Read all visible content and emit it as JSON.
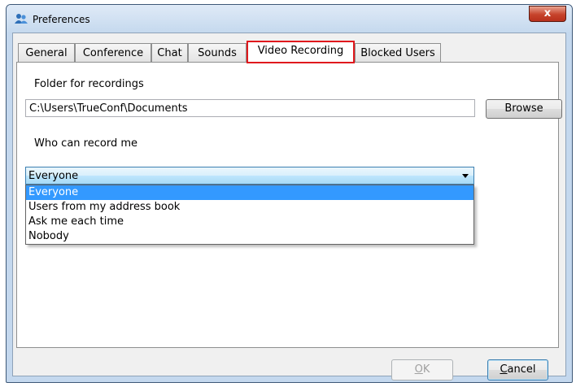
{
  "window": {
    "title": "Preferences",
    "close_label": "x"
  },
  "tabs": [
    {
      "label": "General",
      "active": false
    },
    {
      "label": "Conference",
      "active": false
    },
    {
      "label": "Chat",
      "active": false
    },
    {
      "label": "Sounds",
      "active": false
    },
    {
      "label": "Video Recording",
      "active": true
    },
    {
      "label": "Blocked Users",
      "active": false
    }
  ],
  "recording": {
    "folder_label": "Folder for recordings",
    "folder_value": "C:\\Users\\TrueConf\\Documents",
    "browse_label": "Browse",
    "who_label": "Who can record me",
    "who_selected": "Everyone",
    "options": [
      "Everyone",
      "Users from my address book",
      "Ask me each time",
      "Nobody"
    ]
  },
  "footer": {
    "ok_mnemonic": "O",
    "ok_rest": "K",
    "cancel_mnemonic": "C",
    "cancel_rest": "ancel"
  },
  "colors": {
    "highlight_border": "#e0191d",
    "selection": "#3399ff"
  }
}
